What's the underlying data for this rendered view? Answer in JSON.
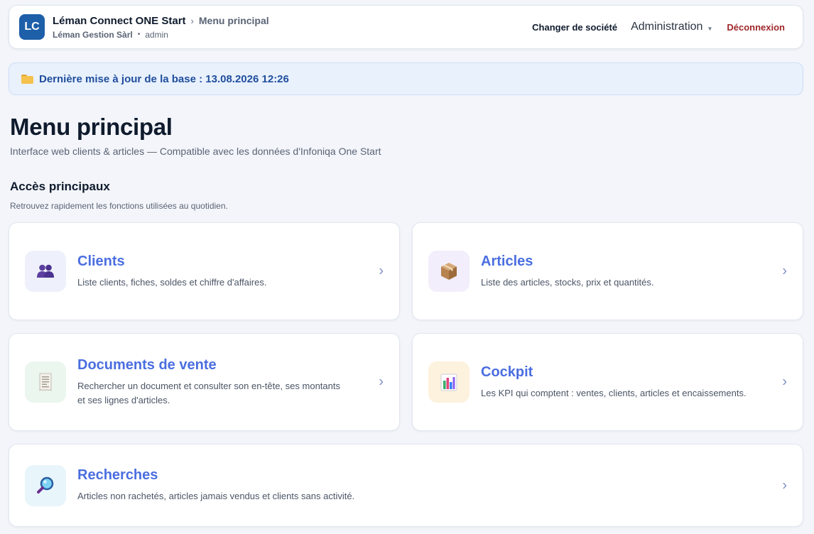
{
  "header": {
    "logo_text": "LC",
    "app_name": "Léman Connect ONE Start",
    "breadcrumb_sep": "›",
    "breadcrumb_current": "Menu principal",
    "company": "Léman Gestion Sàrl",
    "separator": "•",
    "user": "admin",
    "change_company_label": "Changer de société",
    "admin_label": "Administration",
    "admin_caret": "▼",
    "logout_label": "Déconnexion"
  },
  "banner": {
    "icon": "folder-icon",
    "text": "Dernière mise à jour de la base : 13.08.2026 12:26"
  },
  "page": {
    "title": "Menu principal",
    "subtitle": "Interface web clients & articles — Compatible avec les données d'Infoniqa One Start"
  },
  "section": {
    "title": "Accès principaux",
    "description": "Retrouvez rapidement les fonctions utilisées au quotidien."
  },
  "cards": [
    {
      "icon": "users-icon",
      "title": "Clients",
      "desc": "Liste clients, fiches, soldes et chiffre d'affaires.",
      "desc2": "",
      "chevron": "›"
    },
    {
      "icon": "package-icon",
      "title": "Articles",
      "desc": "Liste des articles, stocks, prix et quantités.",
      "desc2": "",
      "chevron": "›"
    },
    {
      "icon": "receipt-icon",
      "title": "Documents de vente",
      "desc": "Rechercher un document et consulter son en-tête, ses montants",
      "desc2": "et ses lignes d'articles.",
      "chevron": "›"
    },
    {
      "icon": "bar-chart-icon",
      "title": "Cockpit",
      "desc": "Les KPI qui comptent : ventes, clients, articles et encaissements.",
      "desc2": "",
      "chevron": "›"
    },
    {
      "icon": "magnifier-icon",
      "title": "Recherches",
      "desc": "Articles non rachetés, articles jamais vendus et clients sans activité.",
      "desc2": "",
      "chevron": "›"
    }
  ],
  "colors": {
    "accent": "#4a6ee0",
    "logo_bg": "#1d5fa8",
    "logout": "#a0282c",
    "banner_bg": "#e9f1fd",
    "banner_text": "#1f4e9c"
  }
}
